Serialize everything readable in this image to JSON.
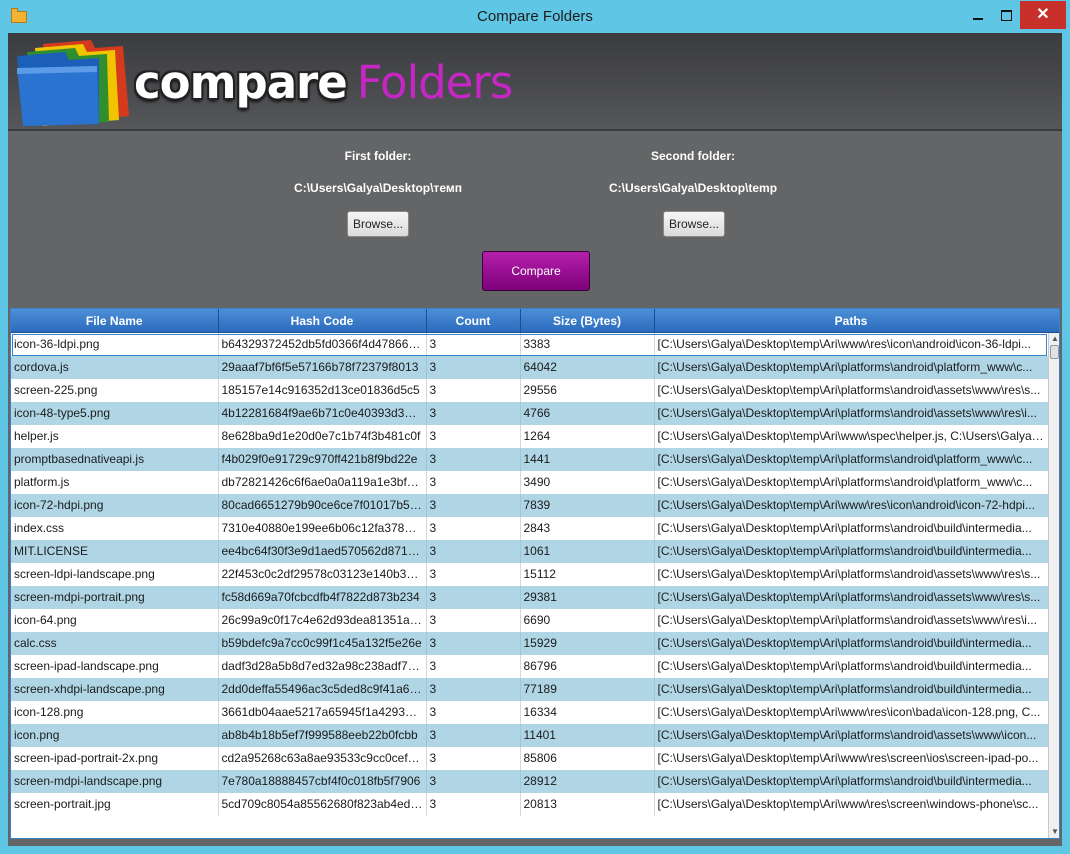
{
  "window": {
    "title": "Compare Folders"
  },
  "brand": {
    "word1": "compare",
    "word2": "Folders",
    "logo_icon": "stacked-folders-icon"
  },
  "first_folder": {
    "label": "First folder:",
    "path": "C:\\Users\\Galya\\Desktop\\темп",
    "browse_label": "Browse..."
  },
  "second_folder": {
    "label": "Second folder:",
    "path": "C:\\Users\\Galya\\Desktop\\temp",
    "browse_label": "Browse..."
  },
  "compare_label": "Compare",
  "colors": {
    "accent_purple": "#9b1a96",
    "header_blue": "#3a7ccc",
    "alt_row": "#b0d6e6",
    "close_red": "#c7302b"
  },
  "table": {
    "columns": [
      "File Name",
      "Hash Code",
      "Count",
      "Size (Bytes)",
      "Paths"
    ],
    "rows": [
      [
        "icon-36-ldpi.png",
        "b64329372452db5fd0366f4d4786608...",
        "3",
        "3383",
        "[C:\\Users\\Galya\\Desktop\\temp\\Ari\\www\\res\\icon\\android\\icon-36-ldpi..."
      ],
      [
        "cordova.js",
        "29aaaf7bf6f5e57166b78f72379f8013",
        "3",
        "64042",
        "[C:\\Users\\Galya\\Desktop\\temp\\Ari\\platforms\\android\\platform_www\\c..."
      ],
      [
        "screen-225.png",
        "185157e14c916352d13ce01836d5c5",
        "3",
        "29556",
        "[C:\\Users\\Galya\\Desktop\\temp\\Ari\\platforms\\android\\assets\\www\\res\\s..."
      ],
      [
        "icon-48-type5.png",
        "4b12281684f9ae6b71c0e40393d3936f",
        "3",
        "4766",
        "[C:\\Users\\Galya\\Desktop\\temp\\Ari\\platforms\\android\\assets\\www\\res\\i..."
      ],
      [
        "helper.js",
        "8e628ba9d1e20d0e7c1b74f3b481c0f",
        "3",
        "1264",
        "[C:\\Users\\Galya\\Desktop\\temp\\Ari\\www\\spec\\helper.js, C:\\Users\\Galya\\..."
      ],
      [
        "promptbasednativeapi.js",
        "f4b029f0e91729c970ff421b8f9bd22e",
        "3",
        "1441",
        "[C:\\Users\\Galya\\Desktop\\temp\\Ari\\platforms\\android\\platform_www\\c..."
      ],
      [
        "platform.js",
        "db72821426c6f6ae0a0a119a1e3bfaa8",
        "3",
        "3490",
        "[C:\\Users\\Galya\\Desktop\\temp\\Ari\\platforms\\android\\platform_www\\c..."
      ],
      [
        "icon-72-hdpi.png",
        "80cad6651279b90ce6ce7f01017b5e4f",
        "3",
        "7839",
        "[C:\\Users\\Galya\\Desktop\\temp\\Ari\\www\\res\\icon\\android\\icon-72-hdpi..."
      ],
      [
        "index.css",
        "7310e40880e199ee6b06c12fa3789d...",
        "3",
        "2843",
        "[C:\\Users\\Galya\\Desktop\\temp\\Ari\\platforms\\android\\build\\intermedia..."
      ],
      [
        "MIT.LICENSE",
        "ee4bc64f30f3e9d1aed570562d8713e7",
        "3",
        "1061",
        "[C:\\Users\\Galya\\Desktop\\temp\\Ari\\platforms\\android\\build\\intermedia..."
      ],
      [
        "screen-ldpi-landscape.png",
        "22f453c0c2df29578c03123e140b353b",
        "3",
        "15112",
        "[C:\\Users\\Galya\\Desktop\\temp\\Ari\\platforms\\android\\assets\\www\\res\\s..."
      ],
      [
        "screen-mdpi-portrait.png",
        "fc58d669a70fcbcdfb4f7822d873b234",
        "3",
        "29381",
        "[C:\\Users\\Galya\\Desktop\\temp\\Ari\\platforms\\android\\assets\\www\\res\\s..."
      ],
      [
        "icon-64.png",
        "26c99a9c0f17c4e62d93dea81351a9cc",
        "3",
        "6690",
        "[C:\\Users\\Galya\\Desktop\\temp\\Ari\\platforms\\android\\assets\\www\\res\\i..."
      ],
      [
        "calc.css",
        "b59bdefc9a7cc0c99f1c45a132f5e26e",
        "3",
        "15929",
        "[C:\\Users\\Galya\\Desktop\\temp\\Ari\\platforms\\android\\build\\intermedia..."
      ],
      [
        "screen-ipad-landscape.png",
        "dadf3d28a5b8d7ed32a98c238adf74f1",
        "3",
        "86796",
        "[C:\\Users\\Galya\\Desktop\\temp\\Ari\\platforms\\android\\build\\intermedia..."
      ],
      [
        "screen-xhdpi-landscape.png",
        "2dd0deffa55496ac3c5ded8c9f41a659",
        "3",
        "77189",
        "[C:\\Users\\Galya\\Desktop\\temp\\Ari\\platforms\\android\\build\\intermedia..."
      ],
      [
        "icon-128.png",
        "3661db04aae5217a65945f1a4293aebf",
        "3",
        "16334",
        "[C:\\Users\\Galya\\Desktop\\temp\\Ari\\www\\res\\icon\\bada\\icon-128.png, C..."
      ],
      [
        "icon.png",
        "ab8b4b18b5ef7f999588eeb22b0fcbb",
        "3",
        "11401",
        "[C:\\Users\\Galya\\Desktop\\temp\\Ari\\platforms\\android\\assets\\www\\icon..."
      ],
      [
        "screen-ipad-portrait-2x.png",
        "cd2a95268c63a8ae93533c9cc0cef4af",
        "3",
        "85806",
        "[C:\\Users\\Galya\\Desktop\\temp\\Ari\\www\\res\\screen\\ios\\screen-ipad-po..."
      ],
      [
        "screen-mdpi-landscape.png",
        "7e780a18888457cbf4f0c018fb5f7906",
        "3",
        "28912",
        "[C:\\Users\\Galya\\Desktop\\temp\\Ari\\platforms\\android\\build\\intermedia..."
      ],
      [
        "screen-portrait.jpg",
        "5cd709c8054a85562680f823ab4edf7c",
        "3",
        "20813",
        "[C:\\Users\\Galya\\Desktop\\temp\\Ari\\www\\res\\screen\\windows-phone\\sc..."
      ]
    ]
  }
}
